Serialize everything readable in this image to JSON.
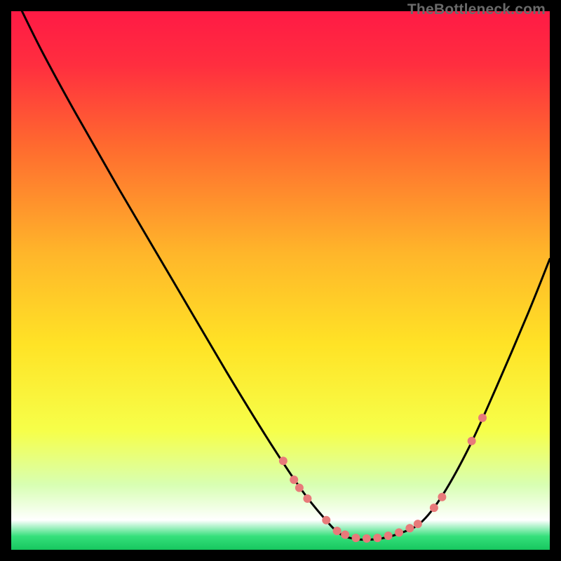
{
  "watermark": "TheBottleneck.com",
  "chart_data": {
    "type": "line",
    "title": "",
    "xlabel": "",
    "ylabel": "",
    "xlim": [
      0,
      100
    ],
    "ylim": [
      0,
      100
    ],
    "grid": false,
    "legend": null,
    "gradient_stops": [
      {
        "offset": 0.0,
        "color": "#ff1a45"
      },
      {
        "offset": 0.1,
        "color": "#ff2e3f"
      },
      {
        "offset": 0.25,
        "color": "#ff6a2f"
      },
      {
        "offset": 0.45,
        "color": "#ffb62a"
      },
      {
        "offset": 0.62,
        "color": "#ffe326"
      },
      {
        "offset": 0.78,
        "color": "#f6ff4a"
      },
      {
        "offset": 0.88,
        "color": "#d8ffb3"
      },
      {
        "offset": 0.945,
        "color": "#ffffff"
      },
      {
        "offset": 0.975,
        "color": "#35e07b"
      },
      {
        "offset": 1.0,
        "color": "#17c75f"
      }
    ],
    "series": [
      {
        "name": "bottleneck-curve",
        "color": "#000000",
        "x": [
          2,
          6,
          12,
          20,
          30,
          40,
          48,
          54,
          58,
          61,
          64,
          68,
          72,
          76,
          80,
          85,
          90,
          96,
          100
        ],
        "y": [
          100,
          92,
          81,
          67,
          50,
          33,
          20,
          11,
          6,
          3,
          2,
          2,
          3,
          5,
          10,
          19,
          30,
          44,
          54
        ]
      }
    ],
    "markers": {
      "name": "highlight-points",
      "color": "#e87a7a",
      "radius": 6,
      "points": [
        {
          "x": 50.5,
          "y": 16.5
        },
        {
          "x": 52.5,
          "y": 13.0
        },
        {
          "x": 53.5,
          "y": 11.5
        },
        {
          "x": 55.0,
          "y": 9.5
        },
        {
          "x": 58.5,
          "y": 5.5
        },
        {
          "x": 60.5,
          "y": 3.5
        },
        {
          "x": 62.0,
          "y": 2.8
        },
        {
          "x": 64.0,
          "y": 2.2
        },
        {
          "x": 66.0,
          "y": 2.1
        },
        {
          "x": 68.0,
          "y": 2.2
        },
        {
          "x": 70.0,
          "y": 2.6
        },
        {
          "x": 72.0,
          "y": 3.2
        },
        {
          "x": 74.0,
          "y": 4.0
        },
        {
          "x": 75.5,
          "y": 4.8
        },
        {
          "x": 78.5,
          "y": 7.8
        },
        {
          "x": 80.0,
          "y": 9.8
        },
        {
          "x": 85.5,
          "y": 20.2
        },
        {
          "x": 87.5,
          "y": 24.5
        }
      ]
    }
  }
}
